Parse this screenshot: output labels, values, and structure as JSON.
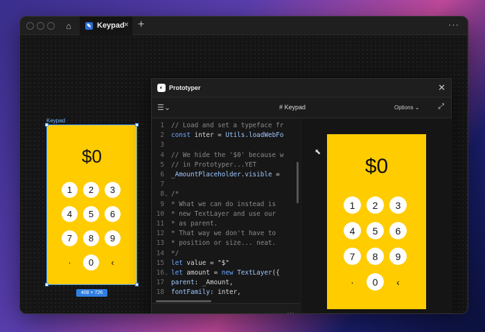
{
  "window": {
    "tab_label": "Keypad",
    "tab_close": "×",
    "new_tab": "+",
    "more": "···"
  },
  "canvas": {
    "frame_label": "Keypad",
    "frame_size": "408 × 726"
  },
  "keypad": {
    "amount": "$0",
    "keys": [
      "1",
      "2",
      "3",
      "4",
      "5",
      "6",
      "7",
      "8",
      "9",
      "·",
      "0",
      "‹"
    ]
  },
  "prototyper": {
    "title": "Prototyper",
    "close": "✕",
    "menu_icon": "☰⌄",
    "file_name": "# Keypad",
    "options_label": "Options ⌄",
    "expand_icon": "⤢",
    "editor_more": "···",
    "code": [
      {
        "n": "1",
        "fold": "",
        "html": "<span class=\"c-com\">// Load and set a typeface fr</span>"
      },
      {
        "n": "2",
        "fold": "",
        "html": "<span class=\"c-kw\">const</span> inter = <span class=\"c-var\">Utils</span>.<span class=\"c-var\">loadWebFo</span>"
      },
      {
        "n": "3",
        "fold": "",
        "html": ""
      },
      {
        "n": "4",
        "fold": "",
        "html": "<span class=\"c-com\">// We hide the '$0' because w</span>"
      },
      {
        "n": "5",
        "fold": "",
        "html": "<span class=\"c-com\">// in Prototyper...YET</span>"
      },
      {
        "n": "6",
        "fold": "",
        "html": "<span class=\"c-var\">_AmountPlaceholder</span>.<span class=\"c-var\">visible</span> ="
      },
      {
        "n": "7",
        "fold": "",
        "html": ""
      },
      {
        "n": "8",
        "fold": "⌄",
        "html": "<span class=\"c-com\">/*</span>"
      },
      {
        "n": "9",
        "fold": "",
        "html": "<span class=\"c-com\"> *  What we can do instead is</span>"
      },
      {
        "n": "10",
        "fold": "",
        "html": "<span class=\"c-com\"> *  new TextLayer and use our</span>"
      },
      {
        "n": "11",
        "fold": "",
        "html": "<span class=\"c-com\"> *  as parent.</span>"
      },
      {
        "n": "12",
        "fold": "",
        "html": "<span class=\"c-com\"> *  That way we don't have to</span>"
      },
      {
        "n": "13",
        "fold": "",
        "html": "<span class=\"c-com\"> *  position or size... neat.</span>"
      },
      {
        "n": "14",
        "fold": "",
        "html": "<span class=\"c-com\"> */</span>"
      },
      {
        "n": "15",
        "fold": "",
        "html": "<span class=\"c-kw\">let</span> value = <span class=\"c-str\">\"$\"</span>"
      },
      {
        "n": "16",
        "fold": "⌄",
        "html": "<span class=\"c-kw\">let</span> amount = <span class=\"c-kw\">new</span> <span class=\"c-var\">TextLayer</span>({"
      },
      {
        "n": "17",
        "fold": "",
        "html": "  <span class=\"c-var\">parent</span>: _Amount,"
      },
      {
        "n": "18",
        "fold": "",
        "html": "  <span class=\"c-var\">fontFamily</span>: inter,"
      }
    ]
  },
  "colors": {
    "keypad_bg": "#ffcc00",
    "selection": "#4aa3ff"
  }
}
